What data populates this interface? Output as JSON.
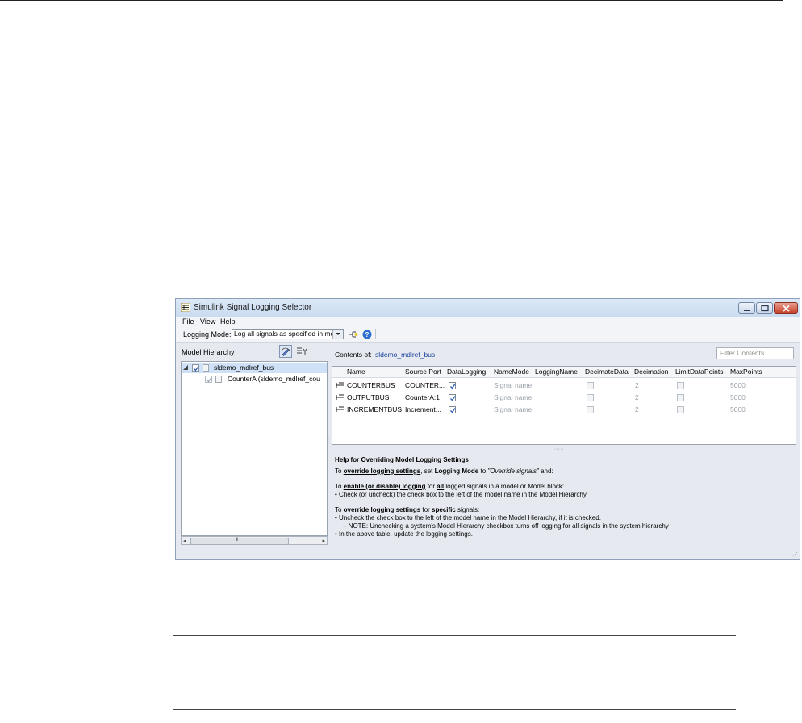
{
  "window": {
    "title": "Simulink Signal Logging Selector",
    "colors": {
      "title_bg": "#c9dbf0",
      "close_btn": "#c7412b",
      "link": "#1a3f9c"
    }
  },
  "menu": [
    "File",
    "View",
    "Help"
  ],
  "toolbar": {
    "mode_label": "Logging Mode:",
    "mode_value": "Log all signals as specified in model",
    "icons": [
      "highlight-signals-icon",
      "help-icon"
    ]
  },
  "left_pane": {
    "title": "Model Hierarchy",
    "tree": [
      {
        "label": "sldemo_mdlref_bus",
        "checked": true,
        "selected": true
      },
      {
        "label": "CounterA (sldemo_mdlref_cou",
        "checked": true,
        "selected": false
      }
    ],
    "scroll_thumb_grip": "III"
  },
  "right_pane": {
    "contents_label": "Contents of:",
    "contents_model": "sldemo_mdlref_bus",
    "filter_placeholder": "Filter Contents",
    "columns": [
      "Name",
      "Source Port",
      "DataLogging",
      "NameMode",
      "LoggingName",
      "DecimateData",
      "Decimation",
      "LimitDataPoints",
      "MaxPoints"
    ],
    "rows": [
      {
        "name": "COUNTERBUS",
        "source_port": "COUNTER...",
        "data_logging": true,
        "logging_name": "Signal name",
        "decimate_data": false,
        "decimation": "2",
        "limit_data_points": false,
        "max_points": "5000"
      },
      {
        "name": "OUTPUTBUS",
        "source_port": "CounterA:1",
        "data_logging": true,
        "logging_name": "Signal name",
        "decimate_data": false,
        "decimation": "2",
        "limit_data_points": false,
        "max_points": "5000"
      },
      {
        "name": "INCREMENTBUS",
        "source_port": "Increment...",
        "data_logging": true,
        "logging_name": "Signal name",
        "decimate_data": false,
        "decimation": "2",
        "limit_data_points": false,
        "max_points": "5000"
      }
    ]
  },
  "help": {
    "heading": "Help for Overriding Model Logging Settings",
    "line1": {
      "a": "To ",
      "b": "override logging settings",
      "c": ", set ",
      "d": "Logging Mode",
      "e": " to ",
      "f": "\"Override signals\"",
      "g": " and:"
    },
    "line2": {
      "a": "To ",
      "b": "enable (or disable) logging",
      "c": " for ",
      "d": "all",
      "e": " logged signals in a model or Model block:"
    },
    "line3": "• Check (or uncheck) the check box to the left of the model name in the Model Hierarchy.",
    "line4": {
      "a": "To ",
      "b": "override logging settings",
      "c": " for ",
      "d": "specific",
      "e": " signals:"
    },
    "line5": "• Uncheck the check box to the left of the model name in the Model Hierarchy, if it is checked.",
    "line6": "– NOTE: Unchecking a system's Model Hierarchy checkbox turns off logging for all signals in the system hierarchy",
    "line7": "• In the above table, update the logging settings."
  }
}
